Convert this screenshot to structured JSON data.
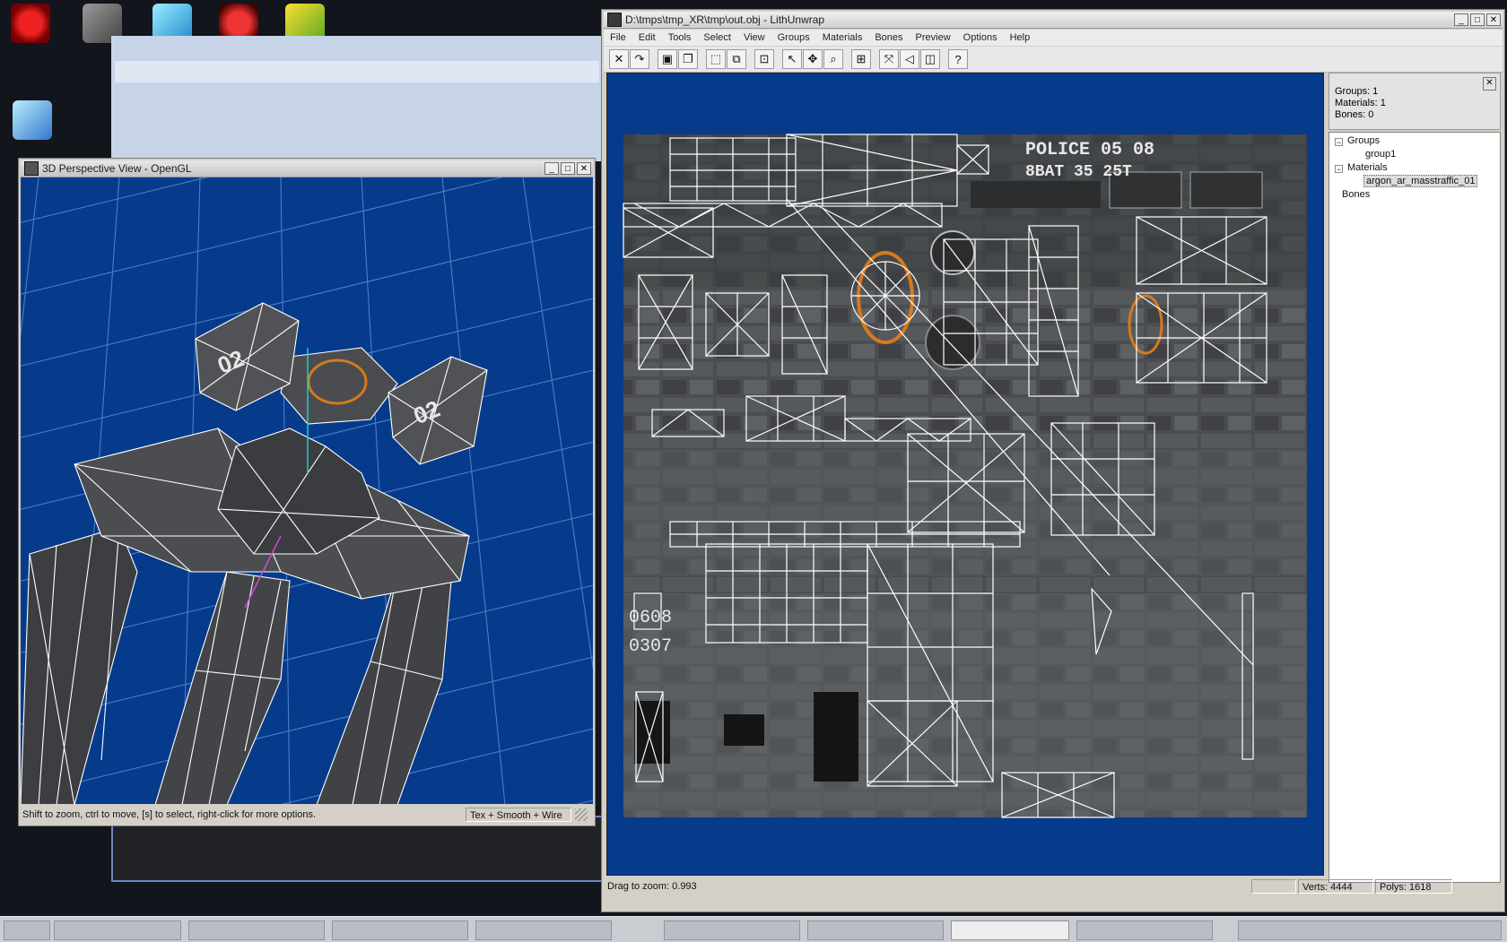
{
  "lith": {
    "title": "D:\\tmps\\tmp_XR\\tmp\\out.obj - LithUnwrap",
    "menus": [
      "File",
      "Edit",
      "Tools",
      "Select",
      "View",
      "Groups",
      "Materials",
      "Bones",
      "Preview",
      "Options",
      "Help"
    ],
    "tools": [
      "close-tool-icon",
      "redo-icon",
      "save-icon",
      "copy-icon",
      "rect-select-icon",
      "lasso-select-icon",
      "fit-icon",
      "pointer-icon",
      "move-icon",
      "zoom-icon",
      "zoom-box-icon",
      "vertex-move-icon",
      "vertex-select-icon",
      "face-select-icon",
      "help-query-icon"
    ],
    "info": {
      "groups": "Groups: 1",
      "materials": "Materials: 1",
      "bones": "Bones: 0"
    },
    "tree": {
      "groups": "Groups",
      "group1": "group1",
      "materials": "Materials",
      "material1": "argon_ar_masstraffic_01",
      "bones": "Bones"
    },
    "texture_text": {
      "line1": "POLICE 05 08",
      "line2": "8BAT 35 25T",
      "side1": "0608",
      "side2": "0307"
    },
    "status": {
      "drag": "Drag to zoom: 0.993",
      "verts": "Verts: 4444",
      "polys": "Polys: 1618"
    }
  },
  "persp": {
    "title": "3D Perspective View - OpenGL",
    "hint": "Shift to zoom, ctrl to move, [s] to select, right-click for more options.",
    "mode": "Tex + Smooth + Wire",
    "pod_label": "02"
  },
  "colors": {
    "viewport_bg": "#0a3a86",
    "grid": "#5f8fd6",
    "wire": "#ffffff",
    "accent": "#d67a1e"
  }
}
